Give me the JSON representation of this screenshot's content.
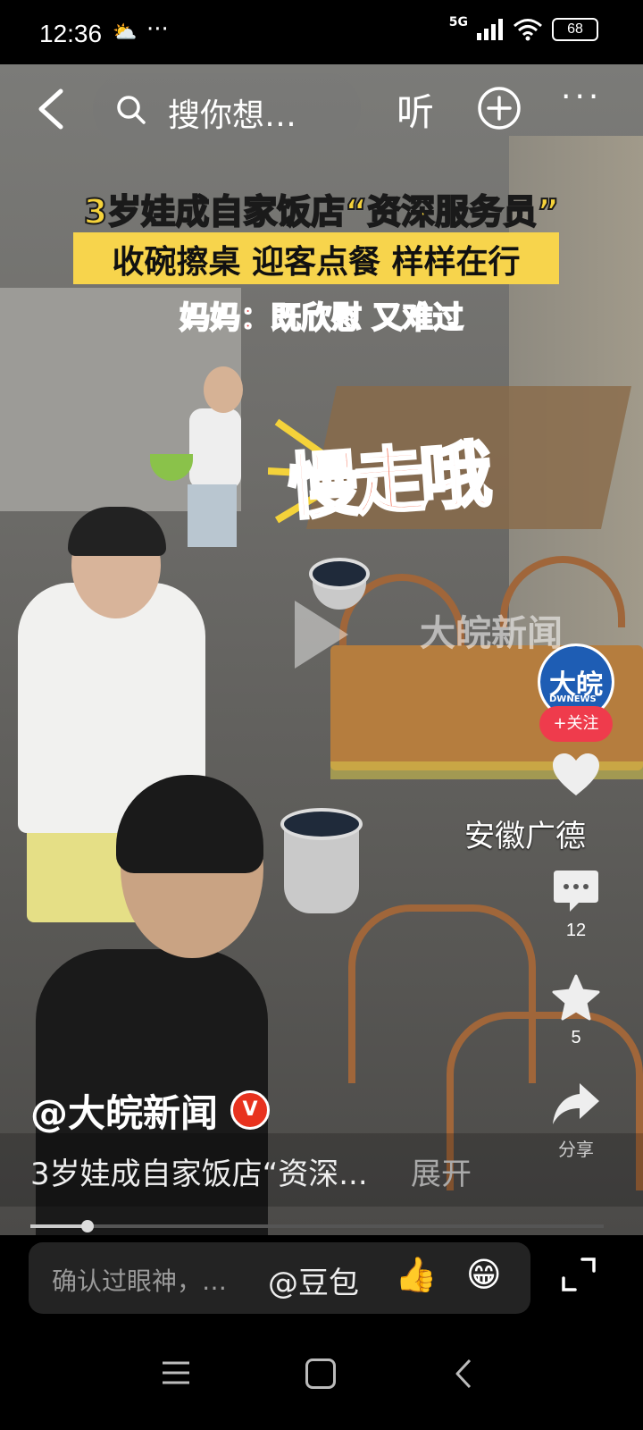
{
  "status_bar": {
    "time": "12:36",
    "weather_icon": "partly-cloudy",
    "dots": "···",
    "network": "5G",
    "battery": "68"
  },
  "top_bar": {
    "search_placeholder": "搜你想…",
    "listen_label": "听"
  },
  "video": {
    "headline_1": "3岁娃成自家饭店“资深服务员”",
    "headline_2": "收碗擦桌 迎客点餐 样样在行",
    "headline_3": "妈妈：既欣慰 又难过",
    "sticker": "慢走哦",
    "watermark": "大皖新闻",
    "progress": 0.1
  },
  "author": {
    "handle": "@大皖新闻",
    "verified_badge": "V",
    "avatar_text": "大皖",
    "avatar_sub": "DWNEWS",
    "follow_label": "+关注"
  },
  "location": "安徽广德",
  "rail": {
    "like_count": "",
    "comment_count": "12",
    "star_count": "5",
    "share_label": "分享"
  },
  "description": {
    "text": "3岁娃成自家饭店“资深...",
    "expand_label": "展开"
  },
  "comment_bar": {
    "placeholder": "确认过眼神，…",
    "mention": "@豆包"
  },
  "colors": {
    "follow_red": "#ef3b4c",
    "headline_yellow": "#f5d23a",
    "headline_red": "#e63a3a"
  }
}
